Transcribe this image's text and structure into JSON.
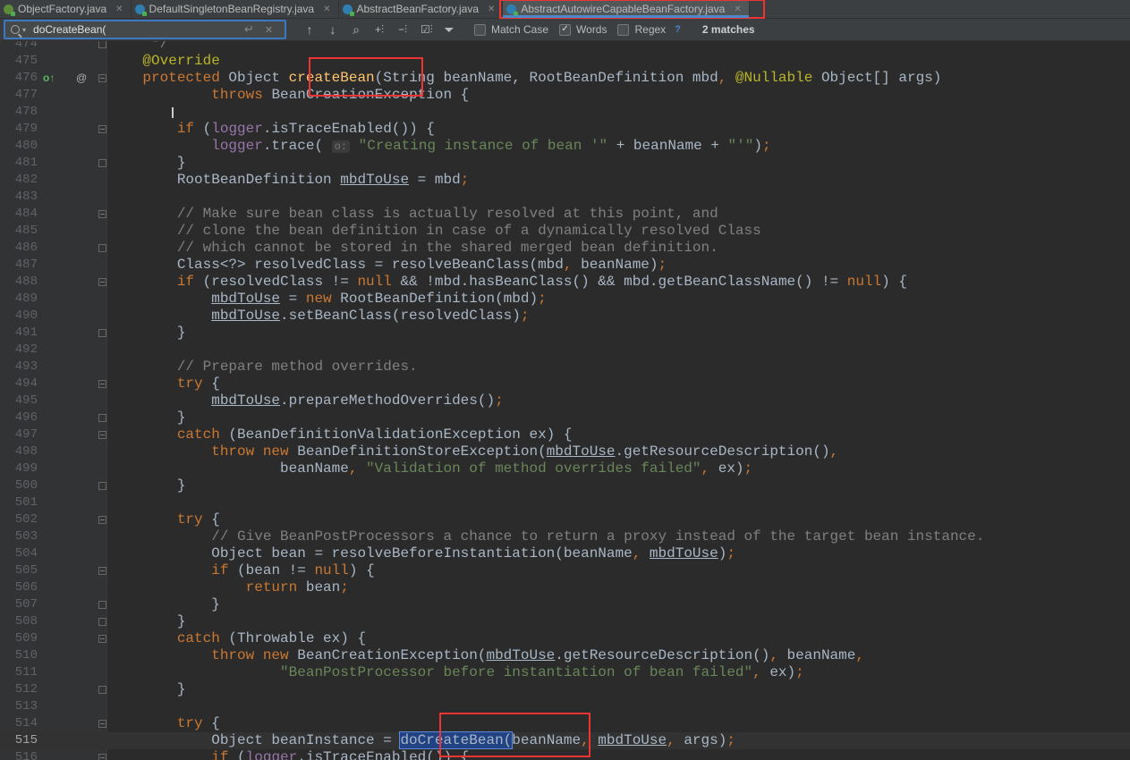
{
  "tabs": [
    {
      "label": "ObjectFactory.java",
      "icon": "interface-file-icon",
      "active": false
    },
    {
      "label": "DefaultSingletonBeanRegistry.java",
      "icon": "class-file-icon",
      "active": false
    },
    {
      "label": "AbstractBeanFactory.java",
      "icon": "class-file-icon",
      "active": false
    },
    {
      "label": "AbstractAutowireCapableBeanFactory.java",
      "icon": "class-file-icon",
      "active": true
    }
  ],
  "search": {
    "query": "doCreateBean(",
    "match_case_label": "Match Case",
    "match_case_checked": false,
    "words_label": "Words",
    "words_checked": true,
    "regex_label": "Regex",
    "regex_checked": false,
    "help": "?",
    "match_count": "2 matches"
  },
  "editor": {
    "current_line": 515,
    "lines": [
      {
        "n": 474,
        "fold": "end",
        "segs": [
          {
            "t": "\t */",
            "c": "cm"
          }
        ]
      },
      {
        "n": 475,
        "segs": [
          {
            "t": "\t@Override",
            "c": "an"
          }
        ]
      },
      {
        "n": 476,
        "fold": "open",
        "marks": [
          "up",
          "at"
        ],
        "segs": [
          {
            "t": "\tprotected ",
            "c": "kw"
          },
          {
            "t": "Object "
          },
          {
            "t": "createBean",
            "c": "fn"
          },
          {
            "t": "(String beanName, RootBeanDefinition mbd"
          },
          {
            "t": ", ",
            "c": "kw"
          },
          {
            "t": "@Nullable",
            "c": "an"
          },
          {
            "t": " Object[] args)"
          }
        ]
      },
      {
        "n": 477,
        "segs": [
          {
            "t": "\t\t\t"
          },
          {
            "t": "throws ",
            "c": "kw"
          },
          {
            "t": "BeanCreationException {"
          }
        ]
      },
      {
        "n": 478,
        "segs": []
      },
      {
        "n": 479,
        "fold": "open",
        "segs": [
          {
            "t": "\t\t"
          },
          {
            "t": "if ",
            "c": "kw"
          },
          {
            "t": "("
          },
          {
            "t": "logger",
            "c": "fd"
          },
          {
            "t": ".isTraceEnabled()) {"
          }
        ]
      },
      {
        "n": 480,
        "segs": [
          {
            "t": "\t\t\t"
          },
          {
            "t": "logger",
            "c": "fd"
          },
          {
            "t": ".trace( "
          },
          {
            "t": "o:",
            "c": "hint"
          },
          {
            "t": " "
          },
          {
            "t": "\"Creating instance of bean '\"",
            "c": "st"
          },
          {
            "t": " + beanName + "
          },
          {
            "t": "\"'\"",
            "c": "st"
          },
          {
            "t": ")"
          },
          {
            "t": ";",
            "c": "kw"
          }
        ]
      },
      {
        "n": 481,
        "fold": "end",
        "segs": [
          {
            "t": "\t\t}"
          }
        ]
      },
      {
        "n": 482,
        "segs": [
          {
            "t": "\t\tRootBeanDefinition "
          },
          {
            "t": "mbdToUse",
            "c": "ul"
          },
          {
            "t": " = mbd"
          },
          {
            "t": ";",
            "c": "kw"
          }
        ]
      },
      {
        "n": 483,
        "segs": []
      },
      {
        "n": 484,
        "fold": "open",
        "segs": [
          {
            "t": "\t\t// Make sure bean class is actually resolved at this point, and",
            "c": "cm"
          }
        ]
      },
      {
        "n": 485,
        "segs": [
          {
            "t": "\t\t// clone the bean definition in case of a dynamically resolved Class",
            "c": "cm"
          }
        ]
      },
      {
        "n": 486,
        "fold": "end",
        "segs": [
          {
            "t": "\t\t// which cannot be stored in the shared merged bean definition.",
            "c": "cm"
          }
        ]
      },
      {
        "n": 487,
        "segs": [
          {
            "t": "\t\tClass<?> resolvedClass = resolveBeanClass(mbd"
          },
          {
            "t": ", ",
            "c": "kw"
          },
          {
            "t": "beanName)"
          },
          {
            "t": ";",
            "c": "kw"
          }
        ]
      },
      {
        "n": 488,
        "fold": "open",
        "segs": [
          {
            "t": "\t\t"
          },
          {
            "t": "if ",
            "c": "kw"
          },
          {
            "t": "(resolvedClass != "
          },
          {
            "t": "null ",
            "c": "kw"
          },
          {
            "t": "&& !mbd.hasBeanClass() && mbd.getBeanClassName() != "
          },
          {
            "t": "null",
            "c": "kw"
          },
          {
            "t": ") {"
          }
        ]
      },
      {
        "n": 489,
        "segs": [
          {
            "t": "\t\t\t"
          },
          {
            "t": "mbdToUse",
            "c": "ul"
          },
          {
            "t": " = "
          },
          {
            "t": "new ",
            "c": "kw"
          },
          {
            "t": "RootBeanDefinition(mbd)"
          },
          {
            "t": ";",
            "c": "kw"
          }
        ]
      },
      {
        "n": 490,
        "segs": [
          {
            "t": "\t\t\t"
          },
          {
            "t": "mbdToUse",
            "c": "ul"
          },
          {
            "t": ".setBeanClass(resolvedClass)"
          },
          {
            "t": ";",
            "c": "kw"
          }
        ]
      },
      {
        "n": 491,
        "fold": "end",
        "segs": [
          {
            "t": "\t\t}"
          }
        ]
      },
      {
        "n": 492,
        "segs": []
      },
      {
        "n": 493,
        "segs": [
          {
            "t": "\t\t// Prepare method overrides.",
            "c": "cm"
          }
        ]
      },
      {
        "n": 494,
        "fold": "open",
        "segs": [
          {
            "t": "\t\t"
          },
          {
            "t": "try ",
            "c": "kw"
          },
          {
            "t": "{"
          }
        ]
      },
      {
        "n": 495,
        "segs": [
          {
            "t": "\t\t\t"
          },
          {
            "t": "mbdToUse",
            "c": "ul"
          },
          {
            "t": ".prepareMethodOverrides()"
          },
          {
            "t": ";",
            "c": "kw"
          }
        ]
      },
      {
        "n": 496,
        "fold": "end",
        "segs": [
          {
            "t": "\t\t}"
          }
        ]
      },
      {
        "n": 497,
        "fold": "open",
        "segs": [
          {
            "t": "\t\t"
          },
          {
            "t": "catch ",
            "c": "kw"
          },
          {
            "t": "(BeanDefinitionValidationException ex) {"
          }
        ]
      },
      {
        "n": 498,
        "segs": [
          {
            "t": "\t\t\t"
          },
          {
            "t": "throw new ",
            "c": "kw"
          },
          {
            "t": "BeanDefinitionStoreException("
          },
          {
            "t": "mbdToUse",
            "c": "ul"
          },
          {
            "t": ".getResourceDescription()"
          },
          {
            "t": ",",
            "c": "kw"
          }
        ]
      },
      {
        "n": 499,
        "segs": [
          {
            "t": "\t\t\t\t\tbeanName"
          },
          {
            "t": ", ",
            "c": "kw"
          },
          {
            "t": "\"Validation of method overrides failed\"",
            "c": "st"
          },
          {
            "t": ", ",
            "c": "kw"
          },
          {
            "t": "ex)"
          },
          {
            "t": ";",
            "c": "kw"
          }
        ]
      },
      {
        "n": 500,
        "fold": "end",
        "segs": [
          {
            "t": "\t\t}"
          }
        ]
      },
      {
        "n": 501,
        "segs": []
      },
      {
        "n": 502,
        "fold": "open",
        "segs": [
          {
            "t": "\t\t"
          },
          {
            "t": "try ",
            "c": "kw"
          },
          {
            "t": "{"
          }
        ]
      },
      {
        "n": 503,
        "segs": [
          {
            "t": "\t\t\t// Give BeanPostProcessors a chance to return a proxy instead of the target bean instance.",
            "c": "cm"
          }
        ]
      },
      {
        "n": 504,
        "segs": [
          {
            "t": "\t\t\tObject bean = resolveBeforeInstantiation(beanName"
          },
          {
            "t": ", ",
            "c": "kw"
          },
          {
            "t": "mbdToUse",
            "c": "ul"
          },
          {
            "t": ")"
          },
          {
            "t": ";",
            "c": "kw"
          }
        ]
      },
      {
        "n": 505,
        "fold": "open",
        "segs": [
          {
            "t": "\t\t\t"
          },
          {
            "t": "if ",
            "c": "kw"
          },
          {
            "t": "(bean != "
          },
          {
            "t": "null",
            "c": "kw"
          },
          {
            "t": ") {"
          }
        ]
      },
      {
        "n": 506,
        "segs": [
          {
            "t": "\t\t\t\t"
          },
          {
            "t": "return ",
            "c": "kw"
          },
          {
            "t": "bean"
          },
          {
            "t": ";",
            "c": "kw"
          }
        ]
      },
      {
        "n": 507,
        "fold": "end",
        "segs": [
          {
            "t": "\t\t\t}"
          }
        ]
      },
      {
        "n": 508,
        "fold": "end",
        "segs": [
          {
            "t": "\t\t}"
          }
        ]
      },
      {
        "n": 509,
        "fold": "open",
        "segs": [
          {
            "t": "\t\t"
          },
          {
            "t": "catch ",
            "c": "kw"
          },
          {
            "t": "(Throwable ex) {"
          }
        ]
      },
      {
        "n": 510,
        "segs": [
          {
            "t": "\t\t\t"
          },
          {
            "t": "throw new ",
            "c": "kw"
          },
          {
            "t": "BeanCreationException("
          },
          {
            "t": "mbdToUse",
            "c": "ul"
          },
          {
            "t": ".getResourceDescription()"
          },
          {
            "t": ", ",
            "c": "kw"
          },
          {
            "t": "beanName"
          },
          {
            "t": ",",
            "c": "kw"
          }
        ]
      },
      {
        "n": 511,
        "segs": [
          {
            "t": "\t\t\t\t\t"
          },
          {
            "t": "\"BeanPostProcessor before instantiation of bean failed\"",
            "c": "st"
          },
          {
            "t": ", ",
            "c": "kw"
          },
          {
            "t": "ex)"
          },
          {
            "t": ";",
            "c": "kw"
          }
        ]
      },
      {
        "n": 512,
        "fold": "end",
        "segs": [
          {
            "t": "\t\t}"
          }
        ]
      },
      {
        "n": 513,
        "segs": []
      },
      {
        "n": 514,
        "fold": "open",
        "segs": [
          {
            "t": "\t\t"
          },
          {
            "t": "try ",
            "c": "kw"
          },
          {
            "t": "{"
          }
        ]
      },
      {
        "n": 515,
        "segs": [
          {
            "t": "\t\t\tObject beanInstance = "
          },
          {
            "t": "doCreateBean(",
            "c": "sel"
          },
          {
            "t": "beanName"
          },
          {
            "t": ", ",
            "c": "kw"
          },
          {
            "t": "mbdToUse",
            "c": "ul"
          },
          {
            "t": ", ",
            "c": "kw"
          },
          {
            "t": "args)"
          },
          {
            "t": ";",
            "c": "kw"
          }
        ]
      },
      {
        "n": 516,
        "fold": "open",
        "segs": [
          {
            "t": "\t\t\t"
          },
          {
            "t": "if ",
            "c": "kw"
          },
          {
            "t": "("
          },
          {
            "t": "logger",
            "c": "fd"
          },
          {
            "t": ".isTraceEnabled()) {"
          }
        ]
      }
    ]
  },
  "colors": {
    "background": "#2b2b2b",
    "keyword": "#cc7832",
    "annotation": "#bbb529",
    "string": "#6a8759",
    "comment": "#808080",
    "method_declaration": "#ffc66d",
    "field": "#9876aa",
    "highlight_box": "#e33333",
    "selection": "#214283"
  }
}
